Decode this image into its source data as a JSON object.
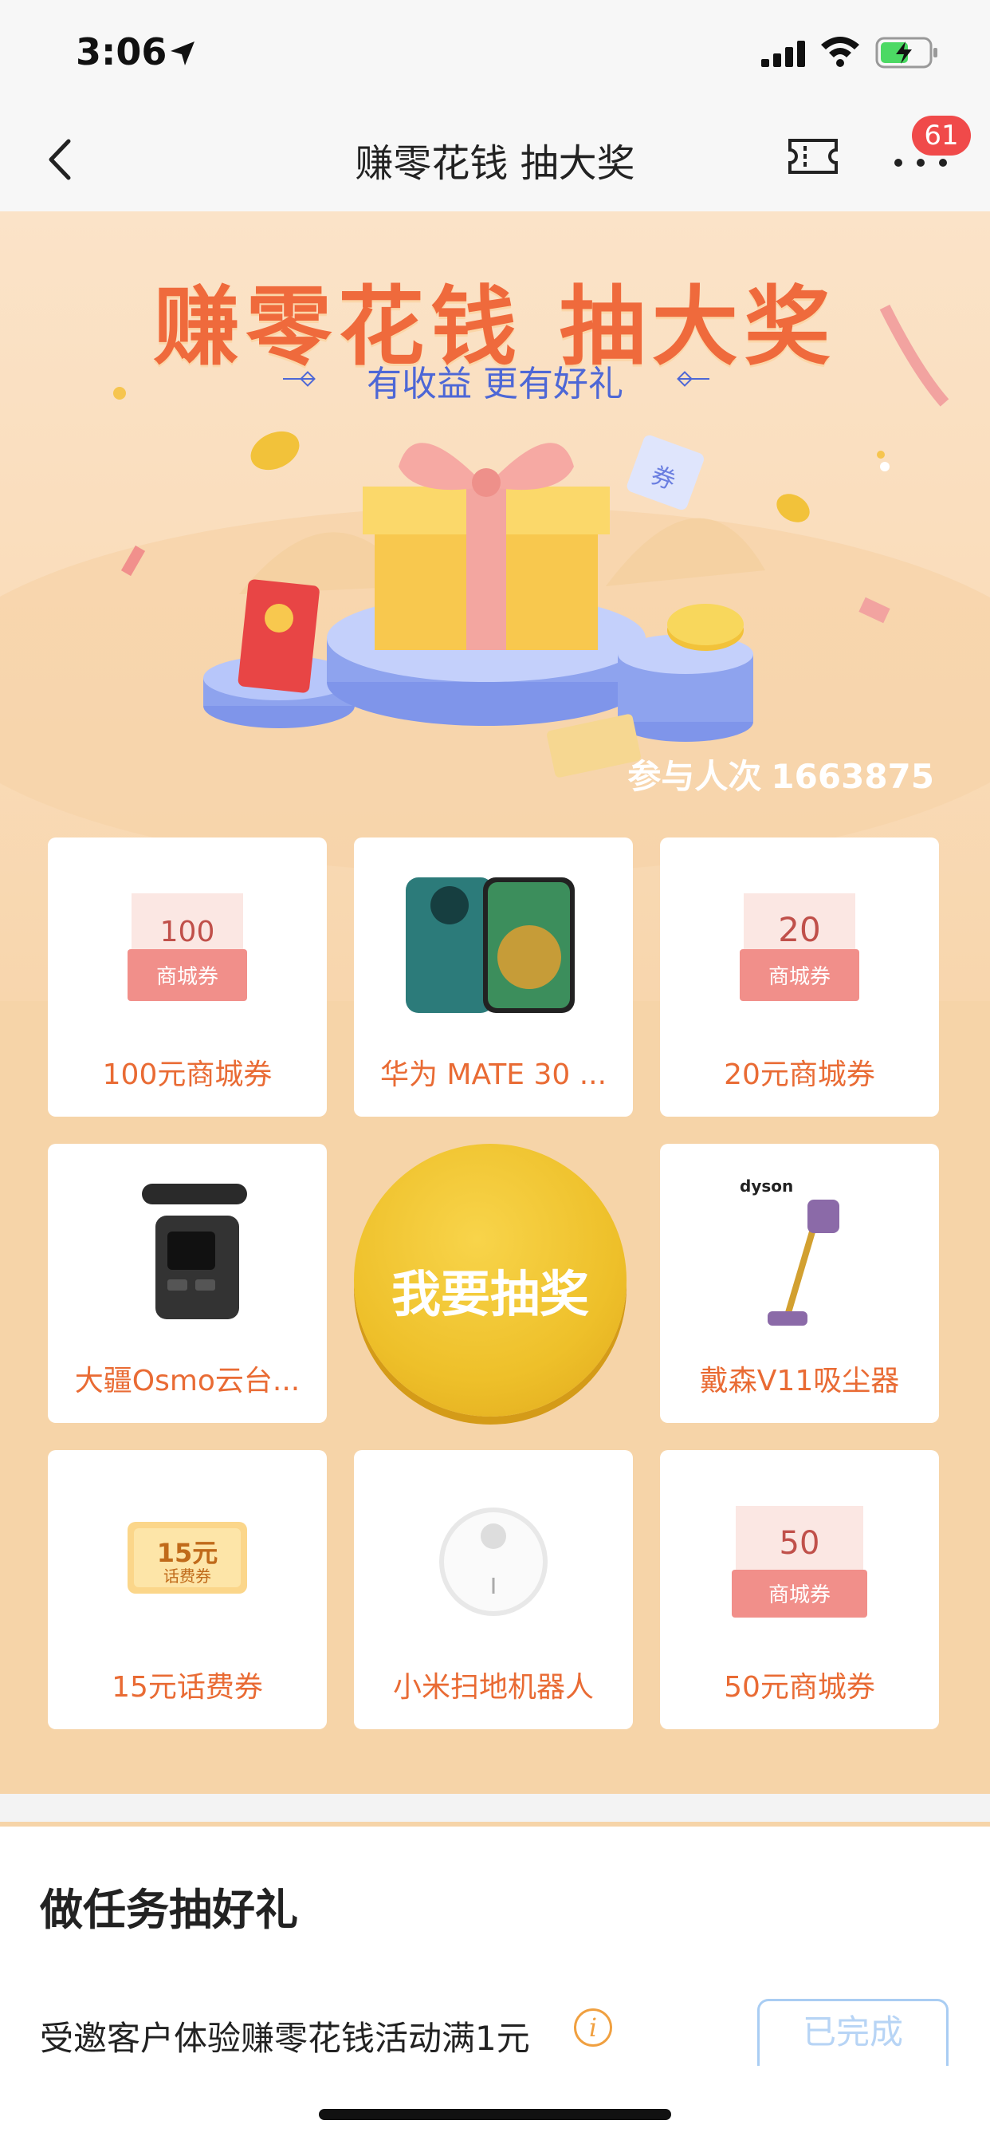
{
  "status": {
    "time": "3:06"
  },
  "nav": {
    "title": "赚零花钱 抽大奖",
    "badge": "61"
  },
  "hero": {
    "title": "赚零花钱 抽大奖",
    "subtitle": "有收益 更有好礼",
    "participants_label": "参与人次",
    "participants_count": "1663875"
  },
  "prizes": [
    {
      "label": "100元商城券",
      "art": "100元 商城券"
    },
    {
      "label": "华为 MATE 30 ..."
    },
    {
      "label": "20元商城券",
      "art": "20元 商城券"
    },
    {
      "label": "大疆Osmo云台..."
    },
    {
      "label": "戴森V11吸尘器",
      "art": "dyson"
    },
    {
      "label": "15元话费券",
      "art": "15元 话费券"
    },
    {
      "label": "小米扫地机器人"
    },
    {
      "label": "50元商城券",
      "art": "50元 商城券"
    }
  ],
  "draw_button": "我要抽奖",
  "tasks": {
    "title": "做任务抽好礼",
    "items": [
      {
        "text": "受邀客户体验赚零花钱活动满1元",
        "status": "已完成"
      }
    ]
  },
  "colors": {
    "accent": "#ef6a3c",
    "label": "#e96b34",
    "sub": "#4d67d6",
    "badge": "#f04a4a",
    "gold": "#f0c23a"
  }
}
